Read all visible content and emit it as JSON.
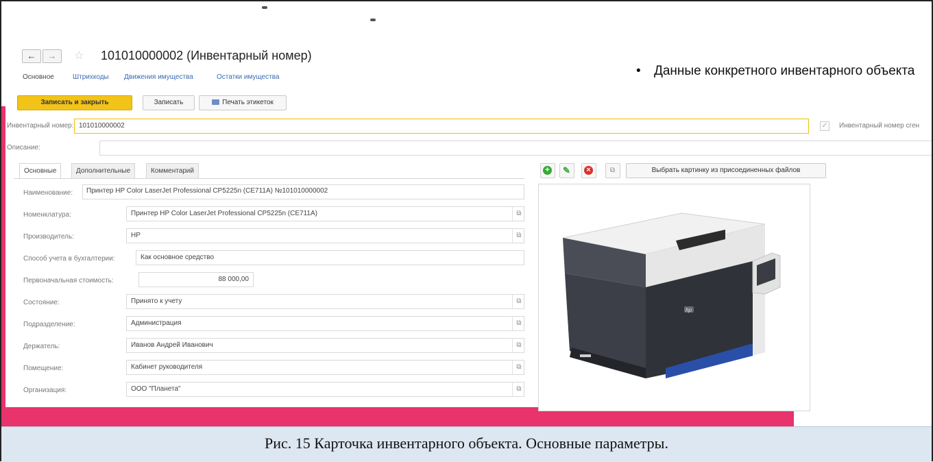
{
  "window": {
    "title": "101010000002 (Инвентарный номер)",
    "nav_back": "←",
    "nav_forward": "→",
    "star": "☆"
  },
  "tabs": [
    {
      "label": "Основное",
      "active": true
    },
    {
      "label": "Штрихкоды",
      "active": false
    },
    {
      "label": "Движения имущества",
      "active": false
    },
    {
      "label": "Остатки имущества",
      "active": false
    }
  ],
  "toolbar": {
    "save_close": "Записать и закрыть",
    "save": "Записать",
    "print_labels": "Печать этикеток"
  },
  "bullet": {
    "marker": "•",
    "text": "Данные конкретного инвентарного объекта"
  },
  "header_fields": {
    "inventory_label": "Инвентарный номер:",
    "inventory_value": "101010000002",
    "description_label": "Описание:",
    "description_value": "",
    "generated_label": "Инвентарный номер сген"
  },
  "subtabs": [
    {
      "label": "Основные",
      "active": true
    },
    {
      "label": "Дополнительные",
      "active": false
    },
    {
      "label": "Комментарий",
      "active": false
    }
  ],
  "form": {
    "name_label": "Наименование:",
    "name_value": "Принтер HP Color LaserJet Professional CP5225n (CE711A) №101010000002",
    "nomenclature_label": "Номенклатура:",
    "nomenclature_value": "Принтер HP Color LaserJet Professional CP5225n (CE711A)",
    "manufacturer_label": "Производитель:",
    "manufacturer_value": "HP",
    "accounting_label": "Способ учета в бухгалтерии:",
    "accounting_value": "Как основное средство",
    "cost_label": "Первоначальная стоимость:",
    "cost_value": "88 000,00",
    "state_label": "Состояние:",
    "state_value": "Принято к учету",
    "division_label": "Подразделение:",
    "division_value": "Администрация",
    "holder_label": "Держатель:",
    "holder_value": "Иванов Андрей Иванович",
    "room_label": "Помещение:",
    "room_value": "Кабинет руководителя",
    "org_label": "Организация:",
    "org_value": "ООО \"Планета\""
  },
  "image_panel": {
    "choose_picture": "Выбрать картинку из присоединенных файлов",
    "logo": "hp"
  },
  "icons": {
    "open": "⧉",
    "check": "✓"
  },
  "colors": {
    "accent_pink": "#e8336d",
    "primary_button": "#f2c318",
    "link": "#3a6bb0",
    "caption_bg": "#dde7f1"
  },
  "caption": "Рис. 15 Карточка инвентарного объекта. Основные параметры."
}
